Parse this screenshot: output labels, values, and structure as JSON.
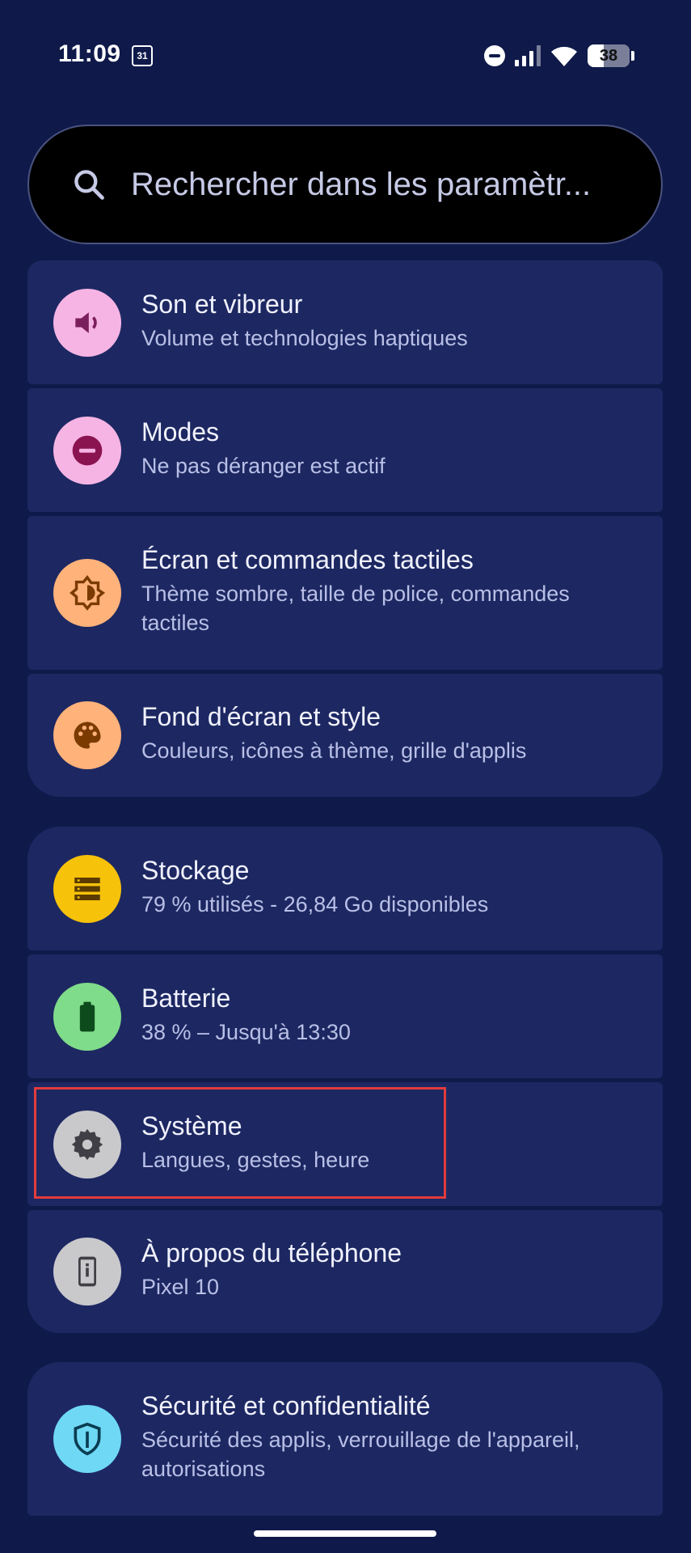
{
  "status": {
    "time": "11:09",
    "calendar_day": "31",
    "battery": "38",
    "battery_level": 0.38
  },
  "search": {
    "placeholder": "Rechercher dans les paramètr..."
  },
  "groups": [
    {
      "items": [
        {
          "title": "Son et vibreur",
          "subtitle": "Volume et technologies haptiques",
          "icon": "speaker-icon",
          "color": "#f6b4e4"
        },
        {
          "title": "Modes",
          "subtitle": "Ne pas déranger est actif",
          "icon": "do-not-disturb-icon",
          "color": "#f6b4e4"
        },
        {
          "title": "Écran et commandes tactiles",
          "subtitle": "Thème sombre, taille de police, commandes tactiles",
          "icon": "brightness-icon",
          "color": "#ffb27a"
        },
        {
          "title": "Fond d'écran et style",
          "subtitle": "Couleurs, icônes à thème, grille d'applis",
          "icon": "palette-icon",
          "color": "#ffb27a"
        }
      ]
    },
    {
      "items": [
        {
          "title": "Stockage",
          "subtitle": "79 % utilisés - 26,84 Go disponibles",
          "icon": "storage-icon",
          "color": "#f6c20a"
        },
        {
          "title": "Batterie",
          "subtitle": "38 % – Jusqu'à 13:30",
          "icon": "battery-icon",
          "color": "#7fdc8a"
        },
        {
          "title": "Système",
          "subtitle": "Langues, gestes, heure",
          "icon": "gear-icon",
          "color": "#c9c9cc"
        },
        {
          "title": "À propos du téléphone",
          "subtitle": "Pixel 10",
          "icon": "phone-info-icon",
          "color": "#c9c9cc"
        }
      ]
    },
    {
      "items": [
        {
          "title": "Sécurité et confidentialité",
          "subtitle": "Sécurité des applis, verrouillage de l'appareil, autorisations",
          "icon": "shield-icon",
          "color": "#6fd8f5"
        }
      ]
    }
  ]
}
